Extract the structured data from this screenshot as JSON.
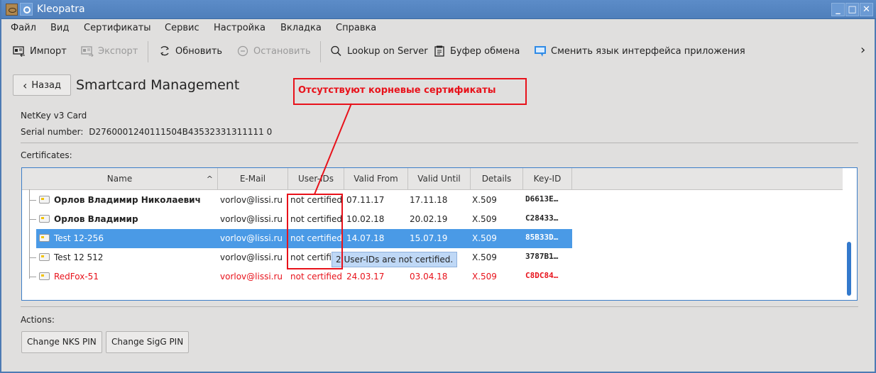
{
  "window": {
    "title": "Kleopatra",
    "controls": [
      "minimize",
      "maximize",
      "close"
    ]
  },
  "menubar": {
    "items": [
      "Файл",
      "Вид",
      "Сертификаты",
      "Сервис",
      "Настройка",
      "Вкладка",
      "Справка"
    ]
  },
  "toolbar": {
    "import_label": "Импорт",
    "export_label": "Экспорт",
    "refresh_label": "Обновить",
    "stop_label": "Остановить",
    "lookup_label": "Lookup on Server",
    "clipboard_label": "Буфер обмена",
    "language_label": "Сменить язык интерфейса приложения",
    "overflow_icon": "chevron-right-icon"
  },
  "header": {
    "back_label": "Назад",
    "title": "Smartcard Management"
  },
  "card": {
    "name": "NetKey v3 Card",
    "serial_label": "Serial number:",
    "serial_value": "D2760001240111504B43532331311111 0"
  },
  "certificates": {
    "label": "Certificates:",
    "columns": [
      "Name",
      "E-Mail",
      "User-IDs",
      "Valid From",
      "Valid Until",
      "Details",
      "Key-ID"
    ],
    "sort_column": "Name",
    "sort_order": "ascending",
    "rows": [
      {
        "name": "Орлов Владимир Николаевич",
        "email": "vorlov@lissi.ru",
        "userids": "not certified",
        "valid_from": "07.11.17",
        "valid_until": "17.11.18",
        "details": "X.509",
        "keyid": "D6613E…",
        "style": "bold"
      },
      {
        "name": "Орлов Владимир",
        "email": "vorlov@lissi.ru",
        "userids": "not certified",
        "valid_from": "10.02.18",
        "valid_until": "20.02.19",
        "details": "X.509",
        "keyid": "C28433…",
        "style": "bold"
      },
      {
        "name": "Test 12-256",
        "email": "vorlov@lissi.ru",
        "userids": "not certified",
        "valid_from": "14.07.18",
        "valid_until": "15.07.19",
        "details": "X.509",
        "keyid": "85B33D…",
        "style": "selected"
      },
      {
        "name": "Test 12 512",
        "email": "vorlov@lissi.ru",
        "userids": "not certified",
        "valid_from": "",
        "valid_until": "",
        "details": "X.509",
        "keyid": "3787B1…",
        "style": "normal"
      },
      {
        "name": "RedFox-51",
        "email": "vorlov@lissi.ru",
        "userids": "not certified",
        "valid_from": "24.03.17",
        "valid_until": "03.04.18",
        "details": "X.509",
        "keyid": "C8DC84…",
        "style": "expired"
      }
    ],
    "tooltip": "2 User-IDs are not certified."
  },
  "annotation": {
    "text": "Отсутствуют корневые сертификаты",
    "color": "#e8121b"
  },
  "actions": {
    "label": "Actions:",
    "buttons": [
      "Change NKS PIN",
      "Change SigG PIN"
    ]
  },
  "colors": {
    "selection": "#4a9ae6",
    "expired": "#e8121b",
    "titlebar": "#5585c2"
  }
}
